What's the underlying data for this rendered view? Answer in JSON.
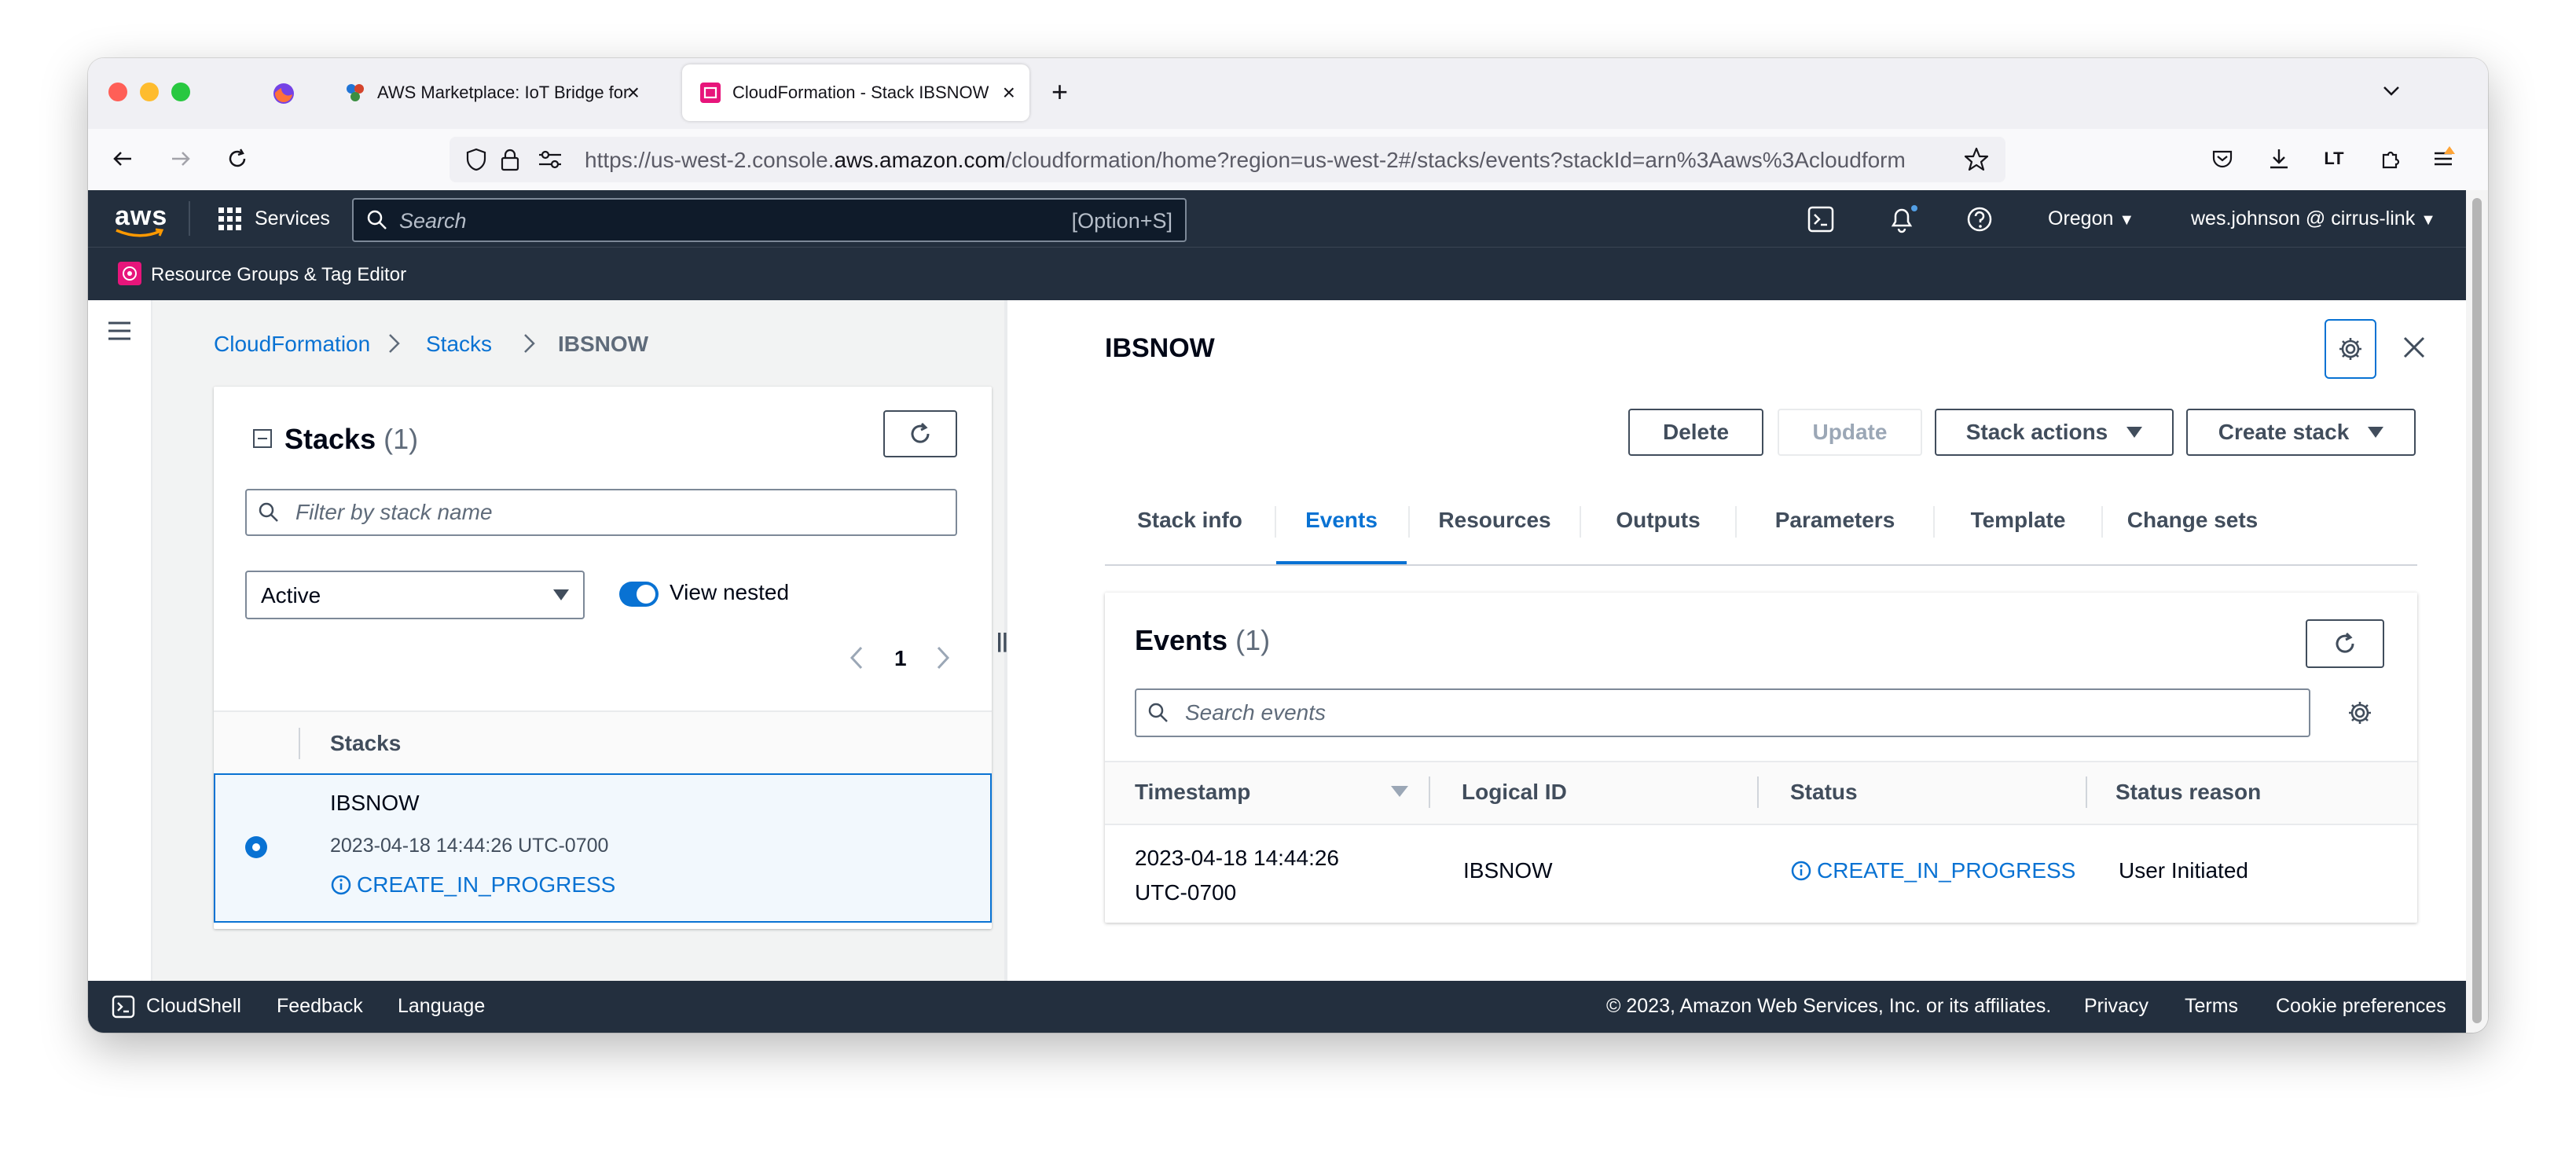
{
  "browser": {
    "tabs": [
      {
        "title": "AWS Marketplace: IoT Bridge for"
      },
      {
        "title": "CloudFormation - Stack IBSNOW"
      }
    ],
    "url_prefix": "https://us-west-2.console.",
    "url_domain": "aws.amazon.com",
    "url_suffix": "/cloudformation/home?region=us-west-2#/stacks/events?stackId=arn%3Aaws%3Acloudform"
  },
  "aws_header": {
    "logo": "aws",
    "services_label": "Services",
    "search_placeholder": "Search",
    "search_shortcut": "[Option+S]",
    "region": "Oregon",
    "user": "wes.johnson @ cirrus-link",
    "sub_item": "Resource Groups & Tag Editor"
  },
  "breadcrumb": {
    "items": [
      "CloudFormation",
      "Stacks"
    ],
    "current": "IBSNOW"
  },
  "stacks_panel": {
    "title": "Stacks",
    "count": "(1)",
    "filter_placeholder": "Filter by stack name",
    "status_filter": "Active",
    "view_nested_label": "View nested",
    "page": "1",
    "column_header": "Stacks",
    "rows": [
      {
        "name": "IBSNOW",
        "timestamp": "2023-04-18 14:44:26 UTC-0700",
        "status": "CREATE_IN_PROGRESS"
      }
    ]
  },
  "detail": {
    "title": "IBSNOW",
    "buttons": {
      "delete": "Delete",
      "update": "Update",
      "stack_actions": "Stack actions",
      "create_stack": "Create stack"
    },
    "tabs": [
      "Stack info",
      "Events",
      "Resources",
      "Outputs",
      "Parameters",
      "Template",
      "Change sets"
    ],
    "active_tab": "Events"
  },
  "events_panel": {
    "title": "Events",
    "count": "(1)",
    "search_placeholder": "Search events",
    "columns": [
      "Timestamp",
      "Logical ID",
      "Status",
      "Status reason"
    ],
    "rows": [
      {
        "timestamp_line1": "2023-04-18 14:44:26",
        "timestamp_line2": "UTC-0700",
        "logical_id": "IBSNOW",
        "status": "CREATE_IN_PROGRESS",
        "status_reason": "User Initiated"
      }
    ]
  },
  "footer": {
    "cloudshell": "CloudShell",
    "feedback": "Feedback",
    "language": "Language",
    "copyright": "© 2023, Amazon Web Services, Inc. or its affiliates.",
    "privacy": "Privacy",
    "terms": "Terms",
    "cookie": "Cookie preferences"
  },
  "colors": {
    "aws_nav": "#232f3e",
    "link_blue": "#0972d3",
    "selected_row_bg": "#f2f8fd",
    "text_dark": "#000716"
  }
}
